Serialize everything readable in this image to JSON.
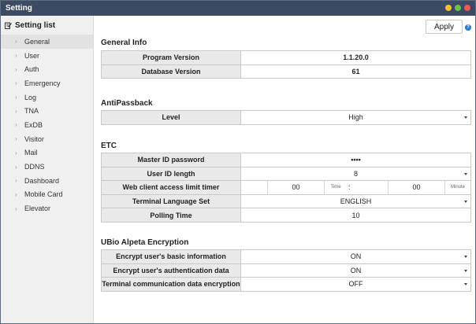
{
  "window": {
    "title": "Setting"
  },
  "sidebar": {
    "header": "Setting list",
    "items": [
      {
        "label": "General"
      },
      {
        "label": "User"
      },
      {
        "label": "Auth"
      },
      {
        "label": "Emergency"
      },
      {
        "label": "Log"
      },
      {
        "label": "TNA"
      },
      {
        "label": "ExDB"
      },
      {
        "label": "Visitor"
      },
      {
        "label": "Mail"
      },
      {
        "label": "DDNS"
      },
      {
        "label": "Dashboard"
      },
      {
        "label": "Mobile Card"
      },
      {
        "label": "Elevator"
      }
    ]
  },
  "toolbar": {
    "apply_label": "Apply",
    "help_glyph": "?"
  },
  "general_info": {
    "title": "General Info",
    "program_version_label": "Program Version",
    "program_version": "1.1.20.0",
    "database_version_label": "Database Version",
    "database_version": "61"
  },
  "antipassback": {
    "title": "AntiPassback",
    "level_label": "Level",
    "level": "High"
  },
  "etc": {
    "title": "ETC",
    "master_id_label": "Master ID password",
    "master_id_value": "••••",
    "user_id_length_label": "User ID length",
    "user_id_length": "8",
    "web_timer_label": "Web client access limit timer",
    "web_timer_hours": "00",
    "web_timer_time_unit": "Time",
    "web_timer_sep": ":",
    "web_timer_minutes": "00",
    "web_timer_minute_unit": "Minute",
    "terminal_language_label": "Terminal Language Set",
    "terminal_language": "ENGLISH",
    "polling_time_label": "Polling Time",
    "polling_time": "10"
  },
  "encryption": {
    "title": "UBio Alpeta Encryption",
    "basic_info_label": "Encrypt user's basic information",
    "basic_info": "ON",
    "auth_data_label": "Encrypt user's authentication data",
    "auth_data": "ON",
    "terminal_comm_label": "Terminal communication data encryption",
    "terminal_comm": "OFF"
  }
}
